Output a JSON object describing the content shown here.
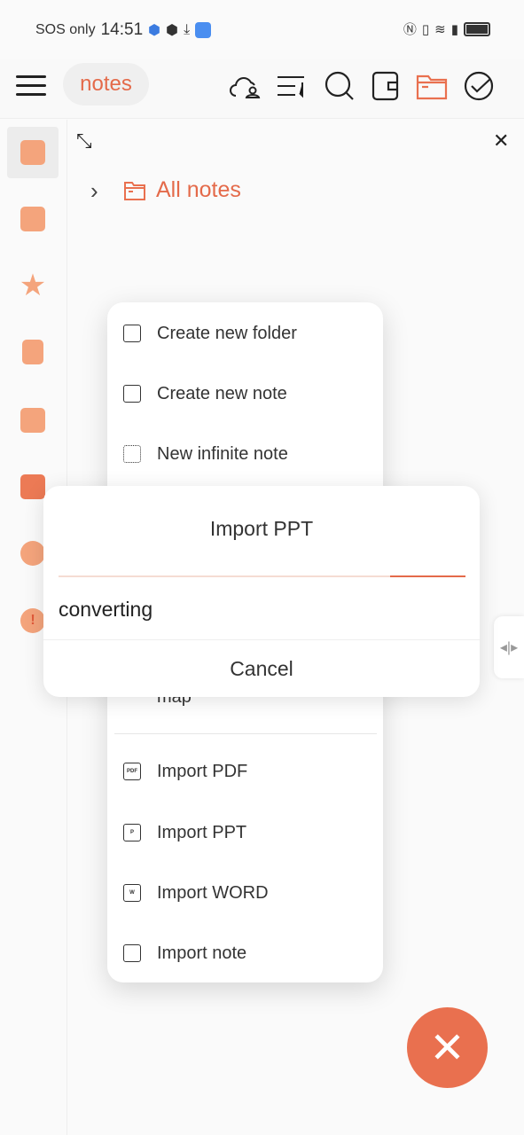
{
  "status_bar": {
    "carrier": "SOS only",
    "time": "14:51",
    "battery_icon": "battery-icon",
    "wifi_icon": "wifi-icon"
  },
  "toolbar": {
    "title": "notes",
    "icons": [
      "menu-icon",
      "cloud-user-icon",
      "sort-icon",
      "search-icon",
      "wallet-icon",
      "folder-icon",
      "check-circle-icon"
    ]
  },
  "breadcrumb": {
    "label": "All notes"
  },
  "sidebar": {
    "icons": [
      "notes-list-icon",
      "note-stack-icon",
      "star-icon",
      "trash-icon",
      "recent-icon",
      "layers-icon",
      "palette-icon",
      "alert-icon"
    ]
  },
  "menu": {
    "items": [
      {
        "label": "Create new folder",
        "icon": "folder-icon"
      },
      {
        "label": "Create new note",
        "icon": "note-icon"
      },
      {
        "label": "New infinite note",
        "icon": "infinite-note-icon"
      },
      {
        "label": "map",
        "icon": ""
      },
      {
        "label": "Import PDF",
        "icon": "pdf-icon"
      },
      {
        "label": "Import PPT",
        "icon": "ppt-icon"
      },
      {
        "label": "Import WORD",
        "icon": "word-icon"
      },
      {
        "label": "Import note",
        "icon": "import-note-icon"
      }
    ]
  },
  "dialog": {
    "title": "Import PPT",
    "status": "converting",
    "cancel_label": "Cancel"
  },
  "colors": {
    "accent": "#e9704f",
    "icon": "#f4a47c"
  }
}
